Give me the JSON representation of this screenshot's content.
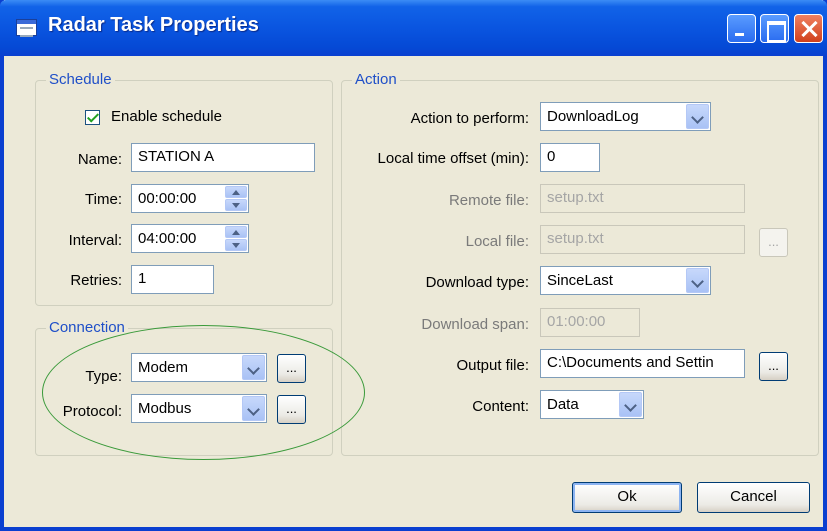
{
  "window": {
    "title": "Radar Task Properties"
  },
  "schedule": {
    "legend": "Schedule",
    "enable_label": "Enable schedule",
    "enable_checked": true,
    "name_label": "Name:",
    "name_value": "STATION A",
    "time_label": "Time:",
    "time_value": "00:00:00",
    "interval_label": "Interval:",
    "interval_value": "04:00:00",
    "retries_label": "Retries:",
    "retries_value": "1"
  },
  "connection": {
    "legend": "Connection",
    "type_label": "Type:",
    "type_value": "Modem",
    "protocol_label": "Protocol:",
    "protocol_value": "Modbus",
    "browse_label": "..."
  },
  "action": {
    "legend": "Action",
    "perform_label": "Action to perform:",
    "perform_value": "DownloadLog",
    "offset_label": "Local time offset (min):",
    "offset_value": "0",
    "remote_label": "Remote file:",
    "remote_value": "setup.txt",
    "local_label": "Local file:",
    "local_value": "setup.txt",
    "dltype_label": "Download type:",
    "dltype_value": "SinceLast",
    "span_label": "Download span:",
    "span_value": "01:00:00",
    "output_label": "Output file:",
    "output_value": "C:\\Documents and Settin",
    "content_label": "Content:",
    "content_value": "Data",
    "browse_label": "..."
  },
  "buttons": {
    "ok": "Ok",
    "cancel": "Cancel"
  },
  "colors": {
    "titlebar": "#0a55e0",
    "legend_text": "#1f4fc8",
    "dialog_bg": "#ece9d8",
    "annotation_ellipse": "#3a9a3a"
  }
}
